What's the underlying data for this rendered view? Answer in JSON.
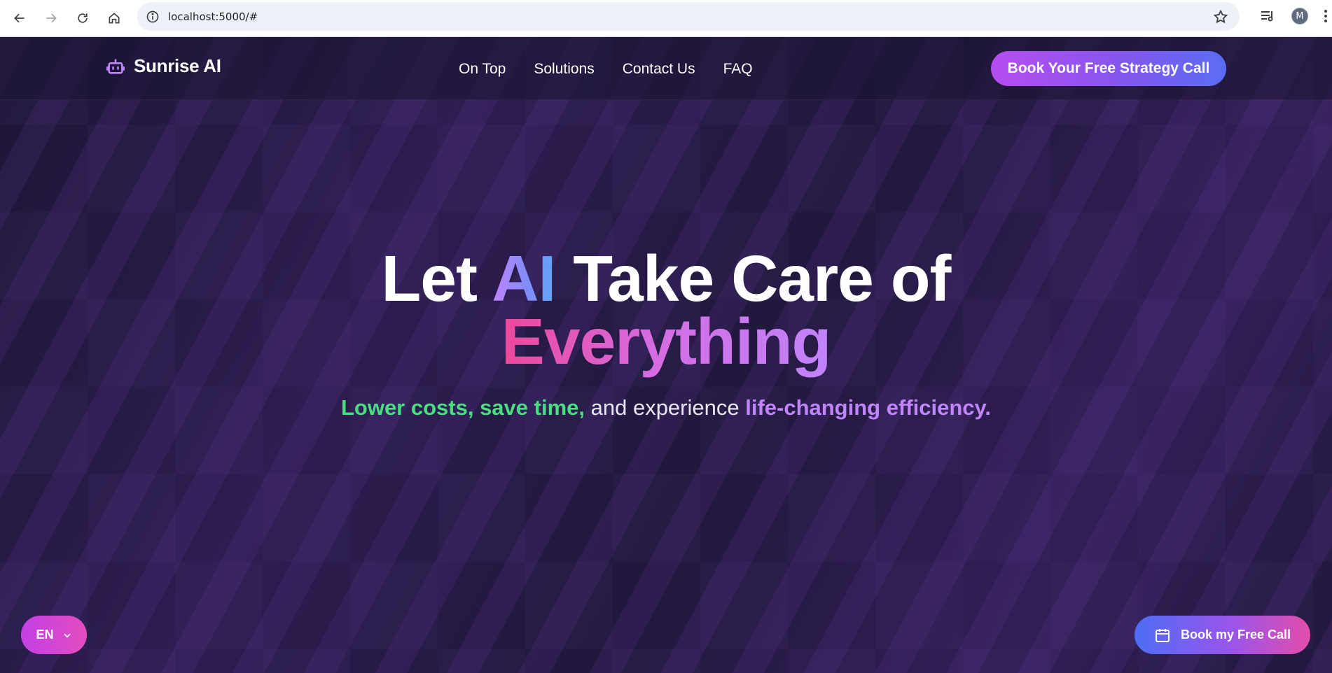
{
  "browser": {
    "url": "localhost:5000/#",
    "avatar_initial": "M",
    "icons": [
      "back-icon",
      "forward-icon",
      "reload-icon",
      "home-icon",
      "info-icon",
      "star-icon",
      "media-control-icon",
      "kebab-menu-icon"
    ]
  },
  "header": {
    "brand_name": "Sunrise AI",
    "brand_icon": "robot-icon",
    "nav": [
      "On Top",
      "Solutions",
      "Contact Us",
      "FAQ"
    ],
    "cta_label": "Book Your Free Strategy Call"
  },
  "hero": {
    "title_part1": "Let ",
    "title_highlight": "AI",
    "title_part2": " Take Care of",
    "title_line2": "Everything",
    "sub_green": "Lower costs, save time,",
    "sub_plain": " and experience ",
    "sub_purple": "life-changing efficiency."
  },
  "floating": {
    "language_label": "EN",
    "book_call_label": "Book my Free Call"
  },
  "colors": {
    "background": "#221a3d",
    "accent_purple": "#c084fc",
    "accent_green": "#4ade80",
    "accent_pink": "#ec4899",
    "accent_blue": "#5a6df2"
  }
}
